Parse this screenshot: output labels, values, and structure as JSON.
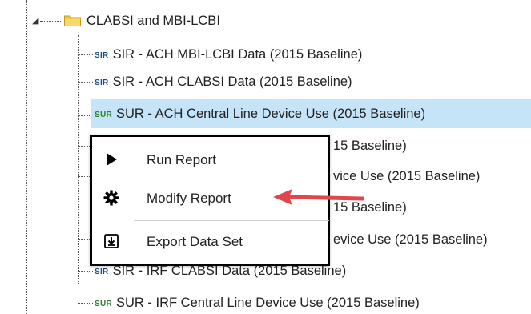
{
  "tree": {
    "folder": {
      "label": "CLABSI and MBI-LCBI",
      "expander": "◢",
      "icon": "folder-icon"
    },
    "items": [
      {
        "badge": "SIR",
        "badge_type": "sir",
        "label": "SIR - ACH MBI-LCBI Data (2015 Baseline)",
        "selected": false
      },
      {
        "badge": "SIR",
        "badge_type": "sir",
        "label": "SIR - ACH CLABSI Data (2015 Baseline)",
        "selected": false
      },
      {
        "badge": "SUR",
        "badge_type": "sur",
        "label": "SUR - ACH Central Line Device Use (2015 Baseline)",
        "selected": true
      },
      {
        "badge": "",
        "badge_type": "sir",
        "label": "15 Baseline)",
        "selected": false,
        "partial": true
      },
      {
        "badge": "",
        "badge_type": "sur",
        "label": "vice Use (2015 Baseline)",
        "selected": false,
        "partial": true
      },
      {
        "badge": "",
        "badge_type": "sir",
        "label": "15 Baseline)",
        "selected": false,
        "partial": true
      },
      {
        "badge": "",
        "badge_type": "sur",
        "label": "evice Use (2015 Baseline)",
        "selected": false,
        "partial": true
      },
      {
        "badge": "SIR",
        "badge_type": "sir",
        "label": "SIR - IRF CLABSI Data (2015 Baseline)",
        "selected": false
      },
      {
        "badge": "SUR",
        "badge_type": "sur",
        "label": "SUR - IRF Central Line Device Use (2015 Baseline)",
        "selected": false
      }
    ]
  },
  "context_menu": {
    "items": [
      {
        "label": "Run Report",
        "icon": "play-icon"
      },
      {
        "label": "Modify Report",
        "icon": "gear-icon"
      },
      {
        "label": "Export Data Set",
        "icon": "download-icon"
      }
    ]
  },
  "colors": {
    "selection": "#c6e4f7",
    "arrow": "#e0474c",
    "menu_border": "#000000",
    "sir_badge": "#1f4e79",
    "sur_badge": "#2e7d32",
    "folder": "#f2c94c"
  }
}
